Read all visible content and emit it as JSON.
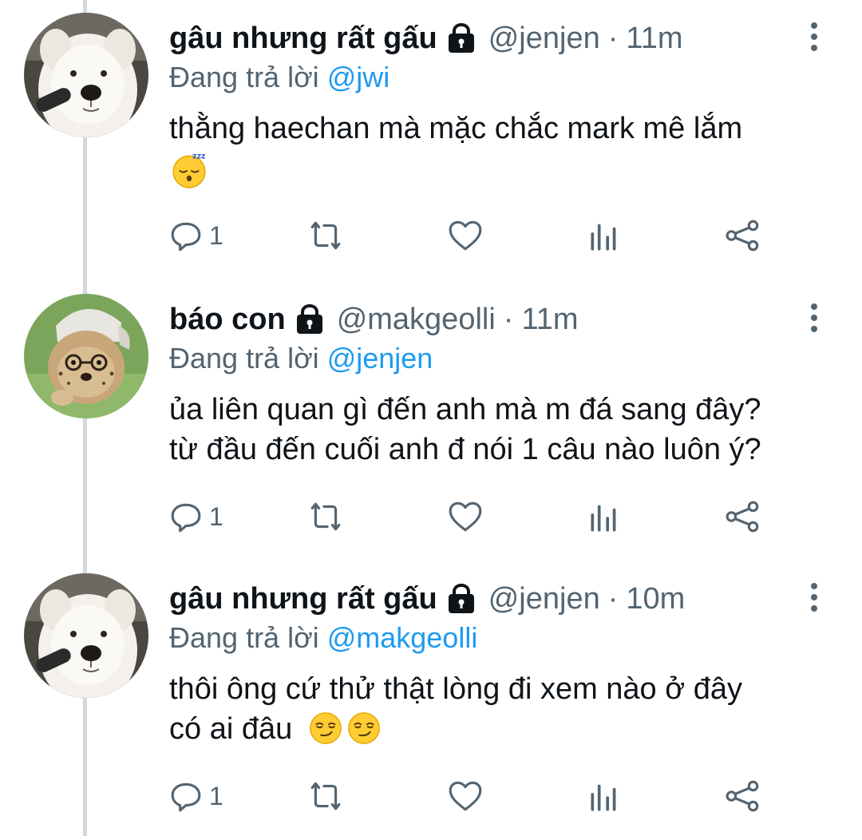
{
  "colors": {
    "accent": "#1d9bf0",
    "secondary_text": "#536471",
    "primary_text": "#0f1419",
    "thread_line": "#cfd9de"
  },
  "tweets": [
    {
      "avatar": "samoyed-dog-avatar",
      "name": "gâu nhưng rất gấu",
      "handle": "@jenjen",
      "dot": "·",
      "time": "11m",
      "reply_prefix": "Đang trả lời",
      "reply_to": "@jwi",
      "text_lines": [
        "thằng haechan mà mặc chắc mark mê lắm"
      ],
      "emojis": [
        "sleeping-face-emoji"
      ],
      "reply_count": "1",
      "icons": [
        "reply-icon",
        "retweet-icon",
        "like-icon",
        "analytics-icon",
        "share-icon"
      ]
    },
    {
      "avatar": "cheetah-cub-avatar",
      "name": "báo con",
      "handle": "@makgeolli",
      "dot": "·",
      "time": "11m",
      "reply_prefix": "Đang trả lời",
      "reply_to": "@jenjen",
      "text_lines": [
        "ủa liên quan gì đến anh mà m đá sang đây?",
        "từ đầu đến cuối anh đ nói 1 câu nào luôn ý?"
      ],
      "emojis": [],
      "reply_count": "1",
      "icons": [
        "reply-icon",
        "retweet-icon",
        "like-icon",
        "analytics-icon",
        "share-icon"
      ]
    },
    {
      "avatar": "samoyed-dog-avatar",
      "name": "gâu nhưng rất gấu",
      "handle": "@jenjen",
      "dot": "·",
      "time": "10m",
      "reply_prefix": "Đang trả lời",
      "reply_to": "@makgeolli",
      "text_lines": [
        "thôi ông cứ thử thật lòng đi xem nào ở đây",
        "có ai đâu"
      ],
      "emojis": [
        "smirking-face-emoji",
        "smirking-face-emoji"
      ],
      "reply_count": "1",
      "icons": [
        "reply-icon",
        "retweet-icon",
        "like-icon",
        "analytics-icon",
        "share-icon"
      ]
    }
  ]
}
